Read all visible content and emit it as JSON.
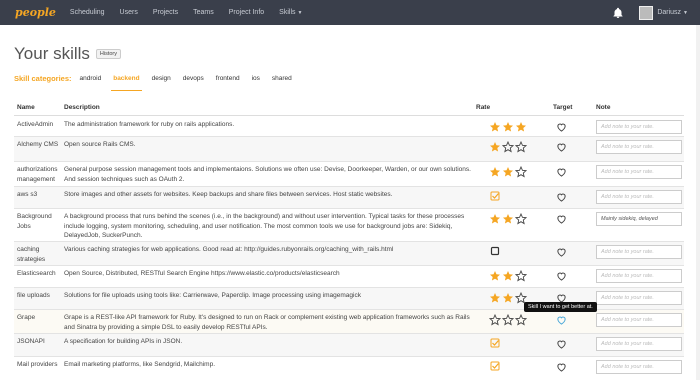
{
  "nav": {
    "brand": "people",
    "links": [
      "Scheduling",
      "Users",
      "Projects",
      "Teams",
      "Project Info",
      "Skills"
    ],
    "user_name": "Dariusz"
  },
  "page": {
    "title": "Your skills",
    "history_label": "History"
  },
  "categories": {
    "label": "Skill categories:",
    "items": [
      "android",
      "backend",
      "design",
      "devops",
      "frontend",
      "ios",
      "shared"
    ],
    "active": "backend"
  },
  "table": {
    "headers": {
      "name": "Name",
      "description": "Description",
      "rate": "Rate",
      "target": "Target",
      "note": "Note"
    },
    "note_placeholder": "Add note to your rate.",
    "rows": [
      {
        "name": "ActiveAdmin",
        "description": "The administration framework for ruby on rails applications.",
        "rate": 3,
        "rate_type": "stars",
        "target": "heart",
        "note": ""
      },
      {
        "name": "Alchemy CMS",
        "description": "Open source Rails CMS.",
        "rate": 1,
        "rate_type": "stars",
        "target": "heart",
        "note": ""
      },
      {
        "name": "authorizations management",
        "description": "General purpose session management tools and implementaions. Solutions we often use: Devise, Doorkeeper, Warden, or our own solutions. And session techniques such as OAuth 2.",
        "rate": 2,
        "rate_type": "stars",
        "target": "heart",
        "note": ""
      },
      {
        "name": "aws s3",
        "description": "Store images and other assets for websites. Keep backups and share files between services. Host static websites.",
        "rate": null,
        "rate_type": "checked",
        "target": "heart",
        "note": ""
      },
      {
        "name": "Background Jobs",
        "description": "A background process that runs behind the scenes (i.e., in the background) and without user intervention. Typical tasks for these processes include logging, system monitoring, scheduling, and user notification. The most common tools we use for background jobs are: Sidekiq, DelayedJob, SuckerPunch.",
        "rate": 2,
        "rate_type": "stars",
        "target": "heart",
        "note": "Mainly sidekiq, delayed"
      },
      {
        "name": "caching strategies",
        "description": "Various caching strategies for web applications. Good read at: http://guides.rubyonrails.org/caching_with_rails.html",
        "rate": null,
        "rate_type": "unchecked",
        "target": "heart",
        "note": ""
      },
      {
        "name": "Elasticsearch",
        "description": "Open Source, Distributed, RESTful Search Engine https://www.elastic.co/products/elasticsearch",
        "rate": 2,
        "rate_type": "stars",
        "target": "heart",
        "note": ""
      },
      {
        "name": "file uploads",
        "description": "Solutions for file uploads using tools like: Carrierwave, Paperclip. Image processing using imagemagick",
        "rate": 2,
        "rate_type": "stars",
        "target": "heart",
        "note": ""
      },
      {
        "name": "Grape",
        "description": "Grape is a REST-like API framework for Ruby. It's designed to run on Rack or complement existing web application frameworks such as Rails and Sinatra by providing a simple DSL to easily develop RESTful APIs.",
        "rate": 0,
        "rate_type": "stars",
        "target": "heart-active",
        "note": ""
      },
      {
        "name": "JSONAPI",
        "description": "A specification for building APIs in JSON.",
        "rate": null,
        "rate_type": "checked",
        "target": "heart",
        "note": ""
      },
      {
        "name": "Mail providers",
        "description": "Email marketing platforms, like Sendgrid, Mailchimp.",
        "rate": null,
        "rate_type": "checked",
        "target": "heart",
        "note": ""
      }
    ]
  },
  "tooltip": {
    "text": "Skill I want to get better at."
  },
  "colors": {
    "accent": "#f5a623",
    "navbar": "#3a3f4b",
    "heart_active": "#4aa8d8"
  }
}
